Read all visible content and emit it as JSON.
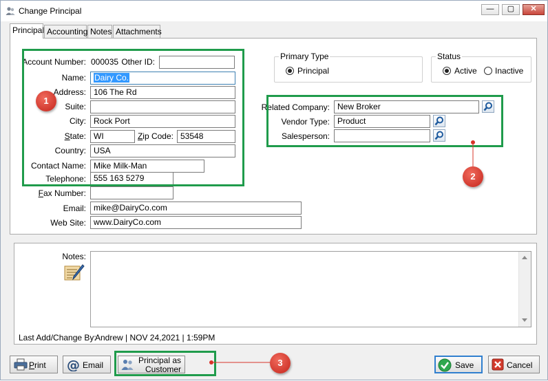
{
  "window": {
    "title": "Change Principal",
    "minimize_label": "—",
    "maximize_label": "▢",
    "close_label": "✕"
  },
  "tabs": [
    {
      "label": "Principal"
    },
    {
      "label": "Accounting"
    },
    {
      "label": "Notes"
    },
    {
      "label": "Attachments"
    }
  ],
  "form": {
    "account_number_label": "Account Number:",
    "account_number_value": "000035",
    "other_id_label": "Other ID:",
    "other_id_value": "",
    "name_label": "Name:",
    "name_value": "Dairy Co.",
    "address_label": "Address:",
    "address_value": "106 The Rd",
    "suite_label": "Suite:",
    "suite_value": "",
    "city_label": "City:",
    "city_value": "Rock Port",
    "state_label": "State:",
    "state_value": "WI",
    "zip_label": "Zip Code:",
    "zip_value": "53548",
    "country_label": "Country:",
    "country_value": "USA",
    "contact_label": "Contact Name:",
    "contact_value": "Mike Milk-Man",
    "telephone_label": "Telephone:",
    "telephone_value": "555 163 5279",
    "fax_label": "Fax Number:",
    "fax_value": "",
    "email_label": "Email:",
    "email_value": "mike@DairyCo.com",
    "website_label": "Web Site:",
    "website_value": "www.DairyCo.com"
  },
  "primary_type": {
    "title": "Primary Type",
    "option": "Principal",
    "selected": true
  },
  "status": {
    "title": "Status",
    "active_label": "Active",
    "inactive_label": "Inactive",
    "selected": "Active"
  },
  "related": {
    "company_label": "Related Company:",
    "company_value": "New Broker",
    "vendor_type_label": "Vendor Type:",
    "vendor_type_value": "Product",
    "salesperson_label": "Salesperson:",
    "salesperson_value": ""
  },
  "notes": {
    "label": "Notes:",
    "value": ""
  },
  "last_change": {
    "label": "Last Add/Change By:",
    "value": "Andrew | NOV 24,2021 |  1:59PM"
  },
  "buttons": {
    "print": "Print",
    "email": "Email",
    "principal_as_customer_line1": "Principal as",
    "principal_as_customer_line2": "Customer",
    "save": "Save",
    "cancel": "Cancel"
  },
  "callouts": [
    "1",
    "2",
    "3"
  ],
  "colors": {
    "highlight": "#1f9b4b",
    "callout": "#d9342a",
    "selection": "#3399ff"
  }
}
